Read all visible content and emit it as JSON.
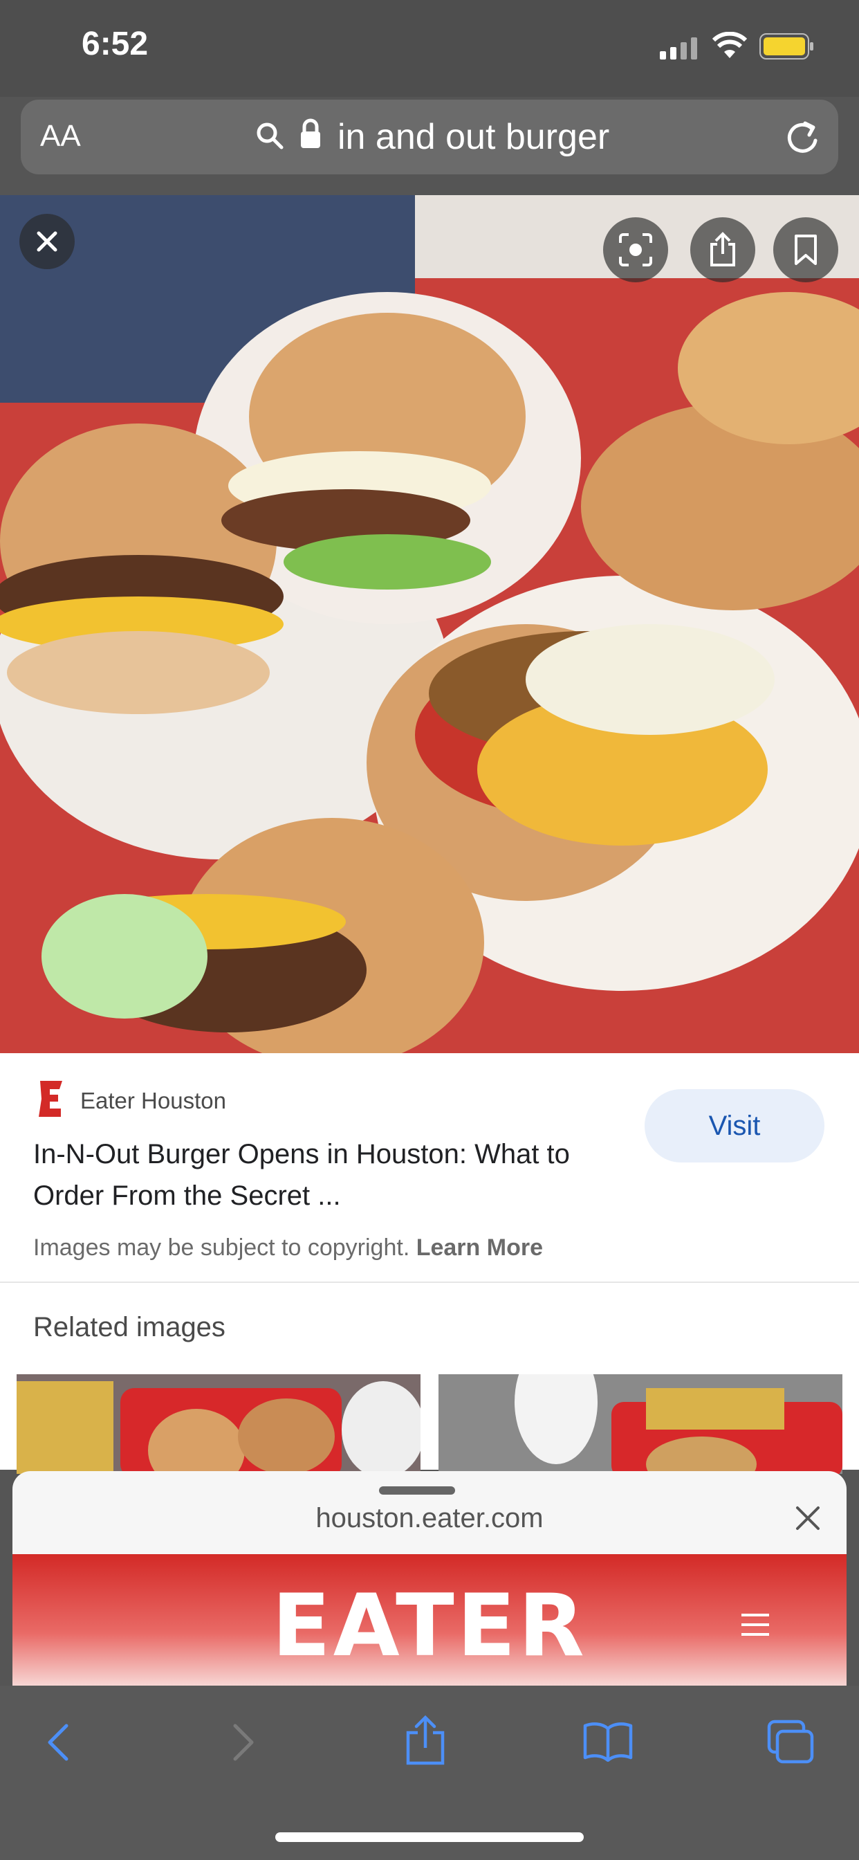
{
  "status_bar": {
    "time": "6:52",
    "battery_color": "#f5d42f"
  },
  "address_bar": {
    "text_size_label": "AA",
    "query": "in and out burger"
  },
  "image_viewer": {
    "icons": [
      "close-icon",
      "lens-icon",
      "share-icon",
      "bookmark-icon"
    ]
  },
  "result": {
    "source_name": "Eater Houston",
    "source_logo_color": "#d32a27",
    "title": "In-N-Out Burger Opens in Houston: What to Order From the Secret ...",
    "visit_label": "Visit",
    "copyright_text": "Images may be subject to copyright.",
    "learn_more_label": "Learn More"
  },
  "related": {
    "heading": "Related images"
  },
  "preview_sheet": {
    "domain": "houston.eater.com",
    "site_logo": "EATER"
  },
  "toolbar": {
    "accent_color": "#4c8ff7",
    "icons": [
      "back-icon",
      "forward-icon",
      "share-icon",
      "bookmarks-icon",
      "tabs-icon"
    ]
  }
}
